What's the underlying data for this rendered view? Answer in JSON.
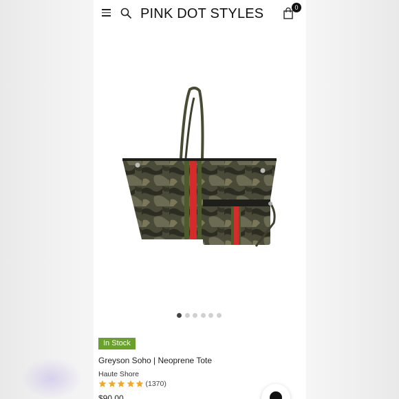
{
  "header": {
    "brand": "PINK DOT STYLES",
    "cart_count": "0",
    "menu_icon": "hamburger-menu-icon",
    "search_icon": "search-icon",
    "cart_icon": "shopping-bag-icon"
  },
  "gallery": {
    "image_description": "camo neoprene tote with red and green stripes and matching wristlet",
    "dot_count": 6,
    "active_index": 0
  },
  "product": {
    "stock_status": "In Stock",
    "title": "Greyson Soho | Neoprene Tote",
    "brand": "Haute Shore",
    "rating_stars": 5,
    "review_count": "(1370)",
    "price": "$90.00"
  },
  "colors": {
    "stock_badge": "#6aa12d",
    "star": "#f0a72a",
    "text": "#222222"
  },
  "chat": {
    "icon": "chat-icon"
  }
}
